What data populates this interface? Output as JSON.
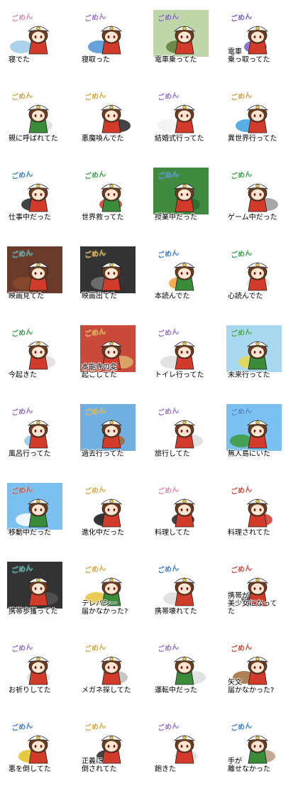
{
  "gomen_text": "ごめん",
  "colors": {
    "hair": "#6a3b1f",
    "hat": "#ffffff",
    "outline": "#222222",
    "dress_red": "#d23a2a",
    "dress_green": "#3a8b3a",
    "gold": "#e8c23a",
    "skin": "#fde7d2"
  },
  "stickers": [
    {
      "caption": "寝でた",
      "gomen_color": "#d98ab0",
      "bg": "#ffffff",
      "prop": "#9ec9e8"
    },
    {
      "caption": "寝取った",
      "gomen_color": "#9a6fc7",
      "bg": "#ffffff",
      "prop": "#4a92d6"
    },
    {
      "caption": "電車乗ってた",
      "gomen_color": "#7a5fbf",
      "bg": "#bfd7a8",
      "prop": "#5b7d3a"
    },
    {
      "caption": "電車\n乗っ取ってた",
      "gomen_color": "#7a5fbf",
      "bg": "#ffffff",
      "prop": "#7a5fbf"
    },
    {
      "caption": "親に呼ばれてた",
      "gomen_color": "#c9a14a",
      "bg": "#ffffff",
      "prop": "#dddddd"
    },
    {
      "caption": "悪魔喚んでた",
      "gomen_color": "#d6a63a",
      "bg": "#ffffff",
      "prop": "#222222"
    },
    {
      "caption": "結婚式行ってた",
      "gomen_color": "#9a6fc7",
      "bg": "#ffffff",
      "prop": "#f2f2f2"
    },
    {
      "caption": "異世界行ってた",
      "gomen_color": "#c9a14a",
      "bg": "#ffffff",
      "prop": "#3aa0e0"
    },
    {
      "caption": "仕事中だった",
      "gomen_color": "#3b7dc9",
      "bg": "#ffffff",
      "prop": "#222222"
    },
    {
      "caption": "世界救ってた",
      "gomen_color": "#3aa04a",
      "bg": "#ffffff",
      "prop": "#d23a2a"
    },
    {
      "caption": "授業中だった",
      "gomen_color": "#3b7dc9",
      "bg": "#3f8a3f",
      "prop": "#2d6a2d"
    },
    {
      "caption": "ゲーム中だった",
      "gomen_color": "#3aa04a",
      "bg": "#ffffff",
      "prop": "#999999"
    },
    {
      "caption": "映画見てた",
      "gomen_color": "#3aa0a0",
      "bg": "#6a3b2a",
      "prop": "#8a4a2a"
    },
    {
      "caption": "映画出てた",
      "gomen_color": "#d6a63a",
      "bg": "#333333",
      "prop": "#777777"
    },
    {
      "caption": "本読んでた",
      "gomen_color": "#3b7dc9",
      "bg": "#ffffff",
      "prop": "#f0a030"
    },
    {
      "caption": "心読んでた",
      "gomen_color": "#3aa04a",
      "bg": "#ffffff",
      "prop": "#dddddd"
    },
    {
      "caption": "今起きた",
      "gomen_color": "#3aa04a",
      "bg": "#ffffff",
      "prop": "#dddddd"
    },
    {
      "caption": "本能寺の変\n起こしてた",
      "gomen_color": "#d6a63a",
      "bg": "#c94a3a",
      "prop": "#e0b070"
    },
    {
      "caption": "トイレ行ってた",
      "gomen_color": "#9a6fc7",
      "bg": "#ffffff",
      "prop": "#dddddd"
    },
    {
      "caption": "未来行ってた",
      "gomen_color": "#3aa04a",
      "bg": "#a8d8f0",
      "prop": "#e8d84a"
    },
    {
      "caption": "風呂行ってた",
      "gomen_color": "#9a6fc7",
      "bg": "#ffffff",
      "prop": "#8fc8e8"
    },
    {
      "caption": "過去行ってた",
      "gomen_color": "#d6a63a",
      "bg": "#6fb0e0",
      "prop": "#a06a3a"
    },
    {
      "caption": "旅行してた",
      "gomen_color": "#9a6fc7",
      "bg": "#ffffff",
      "prop": "#dddddd"
    },
    {
      "caption": "無人島にいた",
      "gomen_color": "#3b7dc9",
      "bg": "#7ac0f0",
      "prop": "#3a9a3a"
    },
    {
      "caption": "移動中だった",
      "gomen_color": "#c94a3a",
      "bg": "#7ac0f0",
      "prop": "#ffffff"
    },
    {
      "caption": "進化中だった",
      "gomen_color": "#d6a63a",
      "bg": "#ffffff",
      "prop": "#111111"
    },
    {
      "caption": "料理してた",
      "gomen_color": "#d98ab0",
      "bg": "#ffffff",
      "prop": "#222222"
    },
    {
      "caption": "料理されてた",
      "gomen_color": "#c94a3a",
      "bg": "#ffffff",
      "prop": "#c93a2a"
    },
    {
      "caption": "携帯歩獲ってた",
      "gomen_color": "#3aa0a0",
      "bg": "#333333",
      "prop": "#555555"
    },
    {
      "caption": "テレパシー\n届かなかった?",
      "gomen_color": "#d6a63a",
      "bg": "#ffffff",
      "prop": "#e8c23a"
    },
    {
      "caption": "携帯壊れてた",
      "gomen_color": "#3b7dc9",
      "bg": "#ffffff",
      "prop": "#dddddd"
    },
    {
      "caption": "携帯が\n美少女になってた",
      "gomen_color": "#c94a3a",
      "bg": "#ffffff",
      "prop": "#444444"
    },
    {
      "caption": "お祈りしてた",
      "gomen_color": "#9a6fc7",
      "bg": "#ffffff",
      "prop": "#dddddd"
    },
    {
      "caption": "メガネ探してた",
      "gomen_color": "#d6a63a",
      "bg": "#ffffff",
      "prop": "#bbbbbb"
    },
    {
      "caption": "運転中だった",
      "gomen_color": "#9a6fc7",
      "bg": "#ffffff",
      "prop": "#dddddd"
    },
    {
      "caption": "矢文\n届かなかった?",
      "gomen_color": "#c94a3a",
      "bg": "#ffffff",
      "prop": "#a06a3a"
    },
    {
      "caption": "悪を倒してた",
      "gomen_color": "#3b7dc9",
      "bg": "#ffffff",
      "prop": "#e0c020"
    },
    {
      "caption": "正義に\n倒されてた",
      "gomen_color": "#d6a63a",
      "bg": "#ffffff",
      "prop": "#222222"
    },
    {
      "caption": "飽きた",
      "gomen_color": "#9a6fc7",
      "bg": "#ffffff",
      "prop": "#dddddd"
    },
    {
      "caption": "手が\n離せなかった",
      "gomen_color": "#3b7dc9",
      "bg": "#ffffff",
      "prop": "#b89a80"
    }
  ]
}
